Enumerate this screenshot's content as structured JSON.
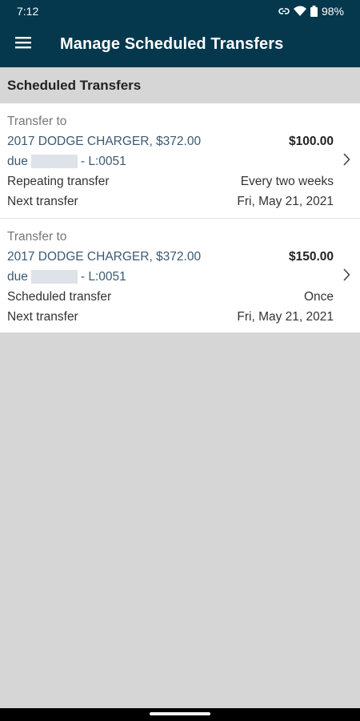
{
  "status": {
    "time": "7:12",
    "battery": "98%"
  },
  "app_bar": {
    "title": "Manage Scheduled Transfers"
  },
  "section": {
    "title": "Scheduled Transfers"
  },
  "transfers": [
    {
      "label": "Transfer to",
      "payee": "2017 DODGE CHARGER, $372.00",
      "amount": "$100.00",
      "due_prefix": "due",
      "account": "- L:0051",
      "type_label": "Repeating transfer",
      "type_value": "Every two weeks",
      "next_label": "Next transfer",
      "next_value": "Fri, May 21, 2021"
    },
    {
      "label": "Transfer to",
      "payee": "2017 DODGE CHARGER, $372.00",
      "amount": "$150.00",
      "due_prefix": "due",
      "account": "- L:0051",
      "type_label": "Scheduled transfer",
      "type_value": "Once",
      "next_label": "Next transfer",
      "next_value": "Fri, May 21, 2021"
    }
  ],
  "colors": {
    "primary": "#05384d",
    "background": "#d6d6d6",
    "link": "#3b5a72"
  },
  "icons": {
    "menu": "hamburger-menu-icon",
    "row": "chevron-right-icon"
  }
}
